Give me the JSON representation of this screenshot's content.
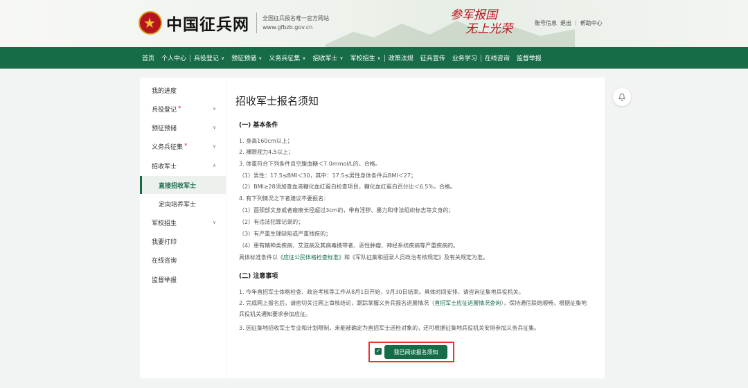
{
  "header": {
    "brand": "中国征兵网",
    "subtitle_line1": "全国征兵报名唯一官方网站",
    "subtitle_line2": "www.gfbzb.gov.cn",
    "slogan_line1": "参军报国",
    "slogan_line2": "无上光荣",
    "links": [
      "账号信息",
      "退出",
      "帮助中心"
    ]
  },
  "nav": {
    "items": [
      {
        "label": "首页"
      },
      {
        "label": "个人中心"
      },
      {
        "label": "兵役登记"
      },
      {
        "label": "预征预储"
      },
      {
        "label": "义务兵征集"
      },
      {
        "label": "招收军士"
      },
      {
        "label": "军校招生"
      },
      {
        "label": "政策法规"
      },
      {
        "label": "征兵宣传"
      },
      {
        "label": "业务学习"
      },
      {
        "label": "在线咨询"
      },
      {
        "label": "监督举报"
      }
    ]
  },
  "sidebar": {
    "items": [
      {
        "label": "我的进度"
      },
      {
        "label": "兵役登记",
        "required": "*"
      },
      {
        "label": "预征预储"
      },
      {
        "label": "义务兵征集",
        "required": "*"
      },
      {
        "label": "招收军士"
      },
      {
        "label": "直接招收军士"
      },
      {
        "label": "定向培养军士"
      },
      {
        "label": "军校招生"
      },
      {
        "label": "我要打印"
      },
      {
        "label": "在线咨询"
      },
      {
        "label": "监督举报"
      }
    ]
  },
  "main": {
    "title": "招收军士报名须知",
    "section1": "(一) 基本条件",
    "basic": [
      "1. 身高160cm以上；",
      "2. 裸眼视力4.5以上；",
      "3. 体重符合下列条件且空腹血糖＜7.0mmol/L的，合格。",
      "（1）男性：17.5≤BMI＜30，其中：17.5≤男性身体条件兵BMI＜27；",
      "（2）BMI≥28须加查血液糖化血红蛋白检查项目，糖化血红蛋白百分比＜6.5%，合格。",
      "4. 有下列情况之下者建议不要报名：",
      "（1）面颈部文身或者瘢痕长径超过3cm的，带有淫秽、暴力和非法组织标志等文身的；",
      "（2）有违法犯罪记录的；",
      "（3）有严重生理缺陷或严重残疾的；",
      "（4）患有精神类疾病、艾滋病及其病毒携带者、恶性肿瘤、神经系统疾病等严重疾病的。"
    ],
    "standard_pre": "具体标准条件以",
    "standard_link1": "《应征公民体格检查标准》",
    "standard_mid": "和《军队征集和招录人员政治考核规定》及有关规定为准。",
    "section2": "(二) 注意事项",
    "note1": "1. 今年直招军士体格检查、政治考核等工作从8月1日开始，9月30日结束。具体时间安排，请咨询征集地兵役机关。",
    "note2_pre": "2. 完成网上报名后，请密切关注网上审核结论，跟踪掌握义务兵报名进展情况（",
    "note2_link": "直招军士应征进展情况查询",
    "note2_post": "），保持通信联络顺畅，根据征集地兵役机关通知要求参加应征。",
    "note3": "3. 因征集地招收军士专业和计划限制，未能被确定为直招军士送检对象的，还可根据征集地兵役机关安排参加义务兵征集。",
    "checkbox_mark": "✓",
    "read_button": "我已阅读报名须知"
  }
}
